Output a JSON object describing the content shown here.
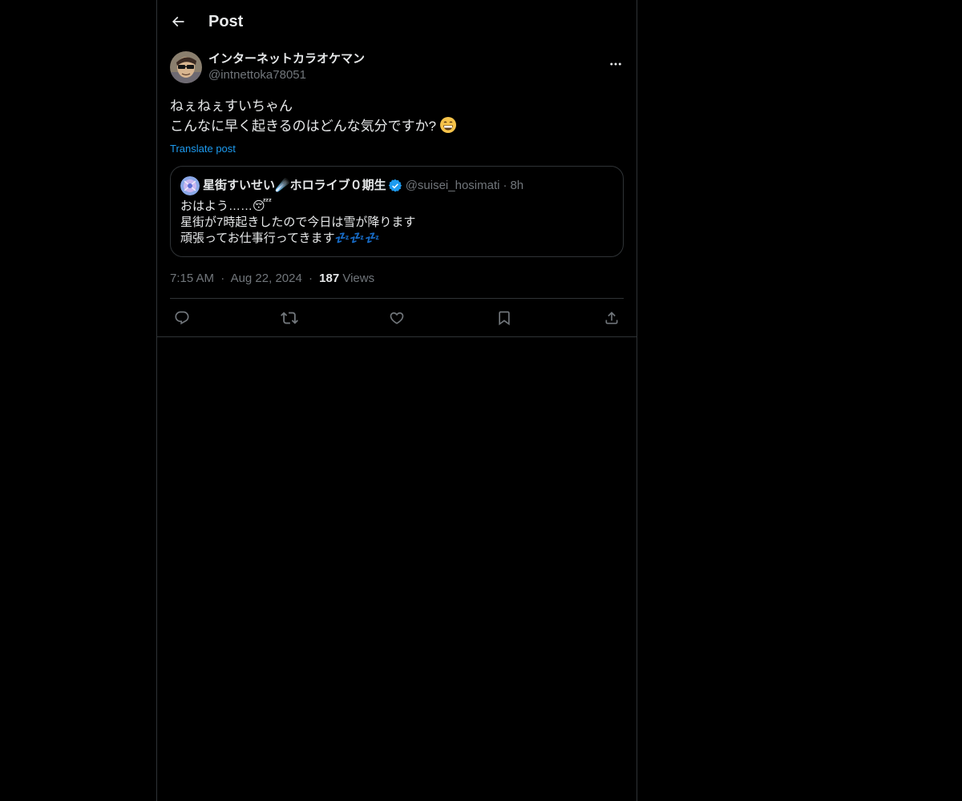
{
  "header": {
    "title": "Post"
  },
  "post": {
    "author": {
      "display_name": "インターネットカラオケマン",
      "handle": "@intnettoka78051"
    },
    "text_lines": [
      "ねぇねぇすいちゃん",
      "こんなに早く起きるのはどんな気分ですか?"
    ],
    "text_emoji": "😁",
    "translate_label": "Translate post",
    "quote": {
      "display_name": "星街すいせい☄️ホロライブ０期生",
      "handle": "@suisei_hosimati",
      "separator": "·",
      "time": "8h",
      "lines": [
        "おはよう……😴",
        "星街が7時起きしたので今日は雪が降ります",
        "頑張ってお仕事行ってきます💤💤💤"
      ]
    },
    "meta": {
      "time": "7:15 AM",
      "separator1": "·",
      "date": "Aug 22, 2024",
      "separator2": "·",
      "views_count": "187",
      "views_label": "Views"
    }
  },
  "colors": {
    "background": "#000000",
    "text_primary": "#e7e9ea",
    "text_secondary": "#71767b",
    "accent": "#1d9bf0",
    "border": "#2f3336"
  },
  "icons": {
    "back": "arrow-left-icon",
    "more": "more-horizontal-icon",
    "reply": "reply-icon",
    "repost": "repost-icon",
    "like": "heart-icon",
    "bookmark": "bookmark-icon",
    "share": "share-icon",
    "verified": "verified-badge-icon"
  }
}
